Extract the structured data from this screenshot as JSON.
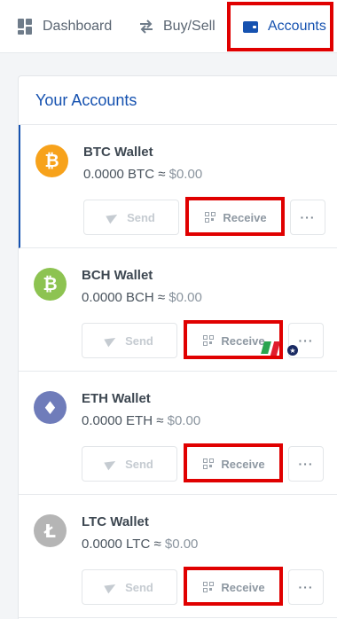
{
  "nav": {
    "dashboard": "Dashboard",
    "buysell": "Buy/Sell",
    "accounts": "Accounts"
  },
  "panel": {
    "title": "Your Accounts"
  },
  "accounts": [
    {
      "name": "BTC Wallet",
      "amount": "0.0000 BTC",
      "approx": "≈",
      "fiat": "$0.00",
      "symbol": "₿",
      "color": "#f7a21b",
      "send": "Send",
      "receive": "Receive",
      "more": "···"
    },
    {
      "name": "BCH Wallet",
      "amount": "0.0000 BCH",
      "approx": "≈",
      "fiat": "$0.00",
      "symbol": "₿",
      "color": "#8dc351",
      "send": "Send",
      "receive": "Receive",
      "more": "···"
    },
    {
      "name": "ETH Wallet",
      "amount": "0.0000 ETH",
      "approx": "≈",
      "fiat": "$0.00",
      "symbol": "♦",
      "color": "#6f7cba",
      "send": "Send",
      "receive": "Receive",
      "more": "···"
    },
    {
      "name": "LTC Wallet",
      "amount": "0.0000 LTC",
      "approx": "≈",
      "fiat": "$0.00",
      "symbol": "Ł",
      "color": "#b5b5b5",
      "send": "Send",
      "receive": "Receive",
      "more": "···"
    }
  ],
  "icons": {
    "dashboard": "grid-icon",
    "buysell": "swap-arrows-icon",
    "accounts": "wallet-icon",
    "send": "paper-plane-icon",
    "receive": "qr-code-icon",
    "more": "ellipsis-icon"
  },
  "colors": {
    "accent": "#1652b0",
    "highlight": "#e00000"
  },
  "overlay_logo": {
    "symbol": "★"
  }
}
